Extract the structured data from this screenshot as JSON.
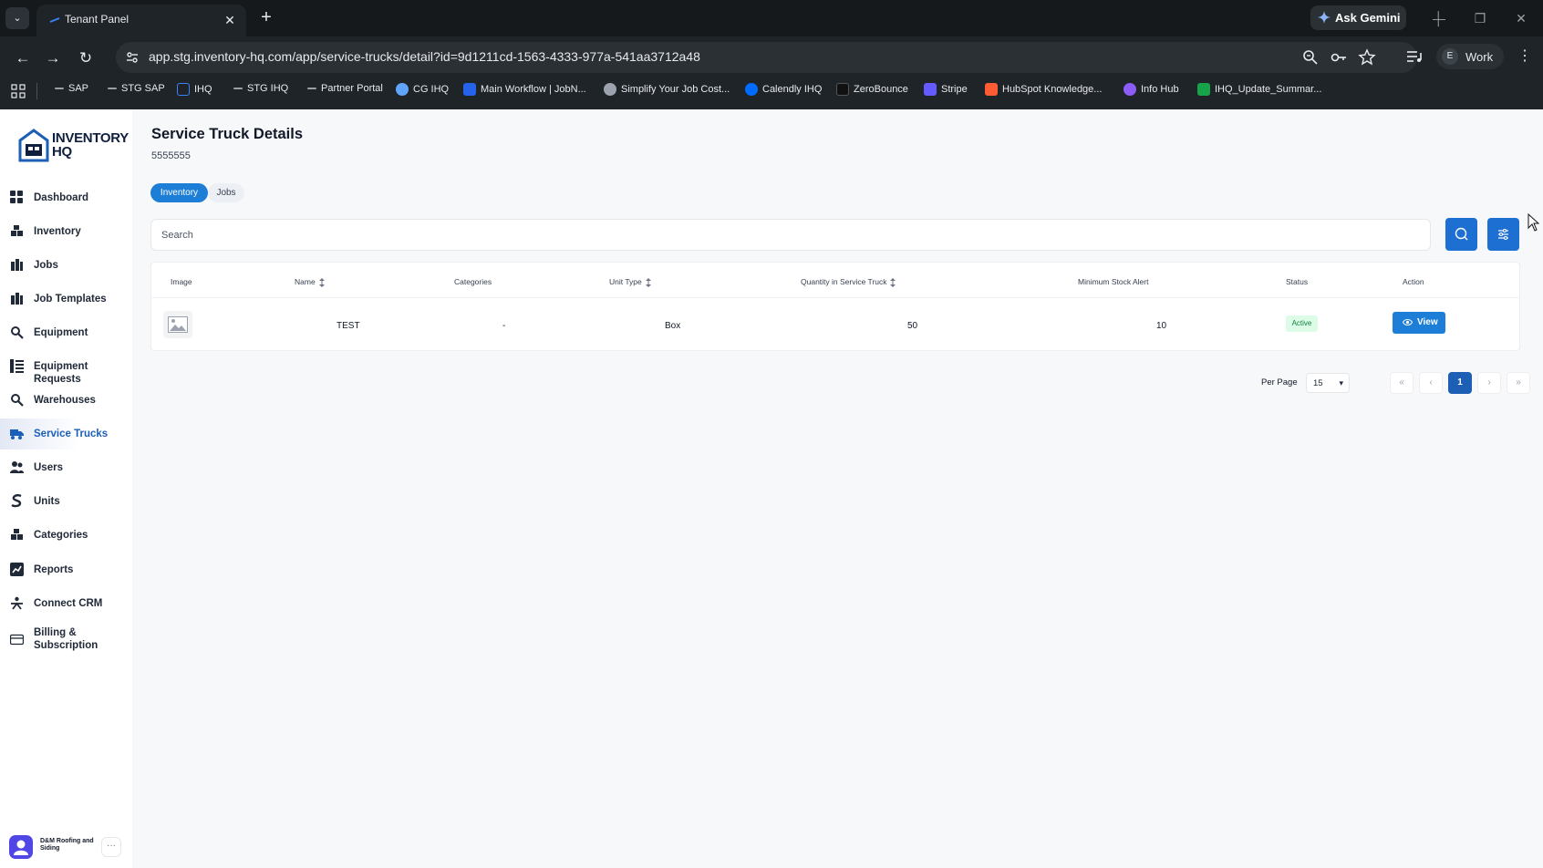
{
  "browser": {
    "tab_title": "Tenant Panel",
    "tab_close": "✕",
    "new_tab": "+",
    "tab_list": "⌄",
    "ask_gemini": "Ask Gemini",
    "url": "app.stg.inventory-hq.com/app/service-trucks/detail?id=9d1211cd-1563-4333-977a-541aa3712a48",
    "profile_initial": "E",
    "profile_label": "Work",
    "bookmarks": [
      {
        "label": "SAP",
        "icon": "dash-icon",
        "color": "#9aa0a6"
      },
      {
        "label": "STG SAP",
        "icon": "dash-icon",
        "color": "#9aa0a6"
      },
      {
        "label": "IHQ",
        "icon": "house-icon",
        "color": "#3b82f6"
      },
      {
        "label": "STG IHQ",
        "icon": "dash-icon",
        "color": "#9aa0a6"
      },
      {
        "label": "Partner Portal",
        "icon": "dash-icon",
        "color": "#9aa0a6"
      },
      {
        "label": "CG IHQ",
        "icon": "globe-icon",
        "color": "#60a5fa"
      },
      {
        "label": "Main Workflow | JobN...",
        "icon": "flag-icon",
        "color": "#2563eb"
      },
      {
        "label": "Simplify Your Job Cost...",
        "icon": "globe-icon",
        "color": "#9ca3af"
      },
      {
        "label": "Calendly IHQ",
        "icon": "calendly-icon",
        "color": "#006bff"
      },
      {
        "label": "ZeroBounce",
        "icon": "zb-icon",
        "color": "#111111"
      },
      {
        "label": "Stripe",
        "icon": "stripe-icon",
        "color": "#635bff"
      },
      {
        "label": "HubSpot Knowledge...",
        "icon": "hubspot-icon",
        "color": "#ff5c35"
      },
      {
        "label": "Info Hub",
        "icon": "info-hub-icon",
        "color": "#8b5cf6"
      },
      {
        "label": "IHQ_Update_Summar...",
        "icon": "sheet-icon",
        "color": "#16a34a"
      }
    ]
  },
  "brand": {
    "line1": "INVENTORY",
    "line2": "HQ"
  },
  "sidebar": {
    "items": [
      {
        "label": "Dashboard",
        "icon": "grid-icon"
      },
      {
        "label": "Inventory",
        "icon": "boxes-icon"
      },
      {
        "label": "Jobs",
        "icon": "jobs-icon"
      },
      {
        "label": "Job Templates",
        "icon": "templates-icon"
      },
      {
        "label": "Equipment",
        "icon": "gear-icon"
      },
      {
        "label": "Equipment Requests",
        "icon": "list-icon"
      },
      {
        "label": "Warehouses",
        "icon": "gear-icon"
      },
      {
        "label": "Service Trucks",
        "icon": "truck-icon",
        "active": true
      },
      {
        "label": "Users",
        "icon": "users-icon"
      },
      {
        "label": "Units",
        "icon": "units-icon"
      },
      {
        "label": "Categories",
        "icon": "boxes-icon"
      },
      {
        "label": "Reports",
        "icon": "chart-icon"
      },
      {
        "label": "Connect CRM",
        "icon": "connect-icon"
      },
      {
        "label": "Billing & Subscription",
        "icon": "card-icon"
      }
    ],
    "user_name": "D&M Roofing and Siding",
    "more": "···"
  },
  "page": {
    "title": "Service Truck Details",
    "subtitle": "5555555",
    "tabs": [
      "Inventory",
      "Jobs"
    ],
    "search_placeholder": "Search"
  },
  "table": {
    "columns": [
      "Image",
      "Name",
      "Categories",
      "Unit Type",
      "Quantity in Service Truck",
      "Minimum Stock Alert",
      "Status",
      "Action"
    ],
    "rows": [
      {
        "name": "TEST",
        "categories": "-",
        "unit_type": "Box",
        "quantity": "50",
        "min_stock": "10",
        "status": "Active",
        "action": "View"
      }
    ]
  },
  "pagination": {
    "per_page_label": "Per Page",
    "per_page_value": "15",
    "first": "«",
    "prev": "‹",
    "current": "1",
    "next": "›",
    "last": "»"
  },
  "colors": {
    "accent": "#1c7ed6",
    "primary_dark": "#1d5fb4",
    "status_active": "#15803d"
  }
}
